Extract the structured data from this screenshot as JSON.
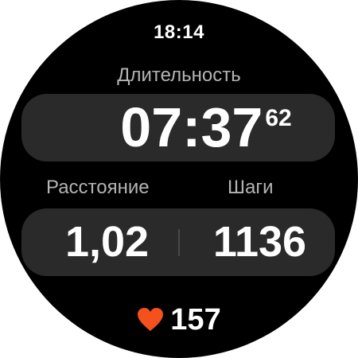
{
  "status_bar": {
    "time": "18:14"
  },
  "workout": {
    "duration": {
      "label": "Длительность",
      "value_main": "07:37",
      "value_centiseconds": "62"
    },
    "distance": {
      "label": "Расстояние",
      "value": "1,02"
    },
    "steps": {
      "label": "Шаги",
      "value": "1136"
    },
    "heart_rate": {
      "icon": "heart-icon",
      "value": "157"
    }
  },
  "colors": {
    "background": "#000000",
    "card": "#2a2a2a",
    "label": "#b4b4b4",
    "heart": "#f4511e"
  }
}
